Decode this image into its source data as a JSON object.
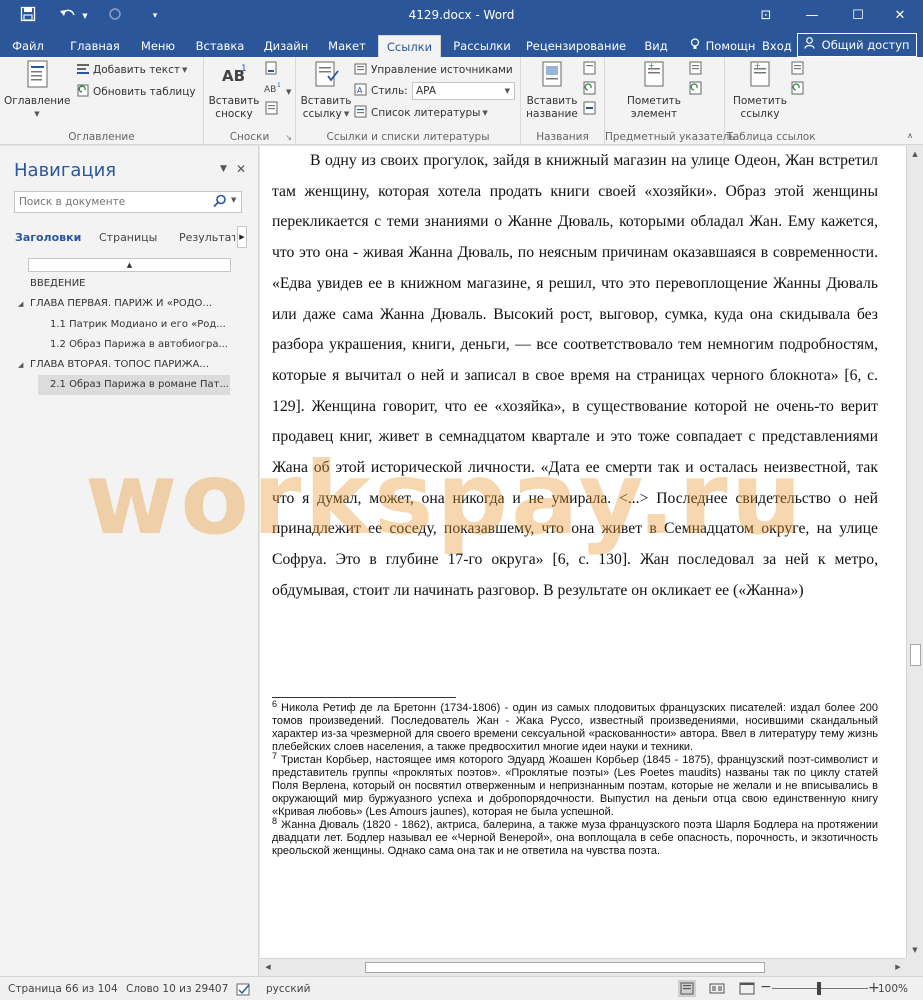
{
  "titlebar": {
    "title": "4129.docx - Word",
    "minimize": "—",
    "maximize": "☐",
    "close": "✕",
    "ribbon_options": "⊡"
  },
  "tabs": [
    {
      "label": "Файл"
    },
    {
      "label": "Главная"
    },
    {
      "label": "Меню"
    },
    {
      "label": "Вставка"
    },
    {
      "label": "Дизайн"
    },
    {
      "label": "Макет"
    },
    {
      "label": "Ссылки"
    },
    {
      "label": "Рассылки"
    },
    {
      "label": "Рецензирование"
    },
    {
      "label": "Вид"
    }
  ],
  "tab_extras": {
    "help": "Помощн",
    "signin": "Вход",
    "share": "Общий доступ"
  },
  "ribbon": {
    "toc": {
      "button": "Оглавление",
      "add_text": "Добавить текст",
      "update_table": "Обновить таблицу",
      "group": "Оглавление"
    },
    "footnotes": {
      "insert": "Вставить",
      "insert2": "сноску",
      "group": "Сноски"
    },
    "citations": {
      "insert": "Вставить",
      "insert2": "ссылку",
      "manage_sources": "Управление источниками",
      "style_label": "Стиль:",
      "style_value": "APA",
      "bibliography": "Список литературы",
      "group": "Ссылки и списки литературы"
    },
    "captions": {
      "insert": "Вставить",
      "insert2": "название",
      "group": "Названия"
    },
    "index": {
      "mark": "Пометить",
      "mark2": "элемент",
      "group": "Предметный указатель"
    },
    "toa": {
      "mark": "Пометить",
      "mark2": "ссылку",
      "group": "Таблица ссылок"
    }
  },
  "nav": {
    "title": "Навигация",
    "search_placeholder": "Поиск в документе",
    "tabs": [
      "Заголовки",
      "Страницы",
      "Результаты"
    ],
    "headings": [
      {
        "text": "ВВЕДЕНИЕ",
        "level": 1,
        "expander": ""
      },
      {
        "text": "ГЛАВА ПЕРВАЯ. ПАРИЖ И «РОДО...",
        "level": 1,
        "expander": "◢"
      },
      {
        "text": "1.1 Патрик Модиано и его «Род...",
        "level": 2,
        "expander": ""
      },
      {
        "text": "1.2 Образ Парижа в автобиогра...",
        "level": 2,
        "expander": ""
      },
      {
        "text": "ГЛАВА ВТОРАЯ. ТОПОС ПАРИЖА...",
        "level": 1,
        "expander": "◢"
      },
      {
        "text": "2.1 Образ Парижа в романе Пат...",
        "level": 2,
        "expander": "",
        "selected": true
      }
    ]
  },
  "document": {
    "paragraph": "В одну из своих прогулок, зайдя в книжный магазин на улице Одеон, Жан встретил там женщину, которая хотела продать книги своей «хозяйки». Образ этой женщины перекликается с теми знаниями о Жанне Дюваль, которыми обладал Жан. Ему кажется, что это она - живая Жанна Дюваль, по неясным причинам оказавшаяся в современности. «Едва увидев ее в книжном магазине, я решил, что это перевоплощение Жанны Дюваль или даже сама Жанна Дюваль. Высокий рост, выговор, сумка, куда она скидывала без разбора украшения, книги, деньги, — все соответствовало тем немногим подробностям, которые я вычитал о ней и записал в свое время на страницах черного блокнота» [6, с. 129]. Женщина говорит, что ее «хозяйка», в существование которой не очень-то верит продавец книг, живет в семнадцатом квартале и это тоже совпадает с представлениями Жана об этой исторической личности. «Дата ее смерти так и осталась неизвестной, так что я думал, может, она никогда и не умирала. <...> Последнее свидетельство о ней принадлежит ее соседу, показавшему, что она живет в Семнадцатом округе, на улице Софруа. Это в глубине 17-го округа» [6, с. 130]. Жан последовал за ней к метро, обдумывая, стоит ли начинать разговор. В результате он окликает ее («Жанна»)",
    "footnotes": [
      {
        "num": "6",
        "text": "Никола Ретиф де ла Бретонн (1734-1806) - один из самых плодовитых французских писателей: издал более 200 томов произведений. Последователь Жан - Жака Руссо, известный произведениями, носившими скандальный характер из-за чрезмерной для своего времени сексуальной «раскованности» автора. Ввел в литературу тему жизнь плебейских слоев населения, а также предвосхитил многие идеи науки и техники."
      },
      {
        "num": "7",
        "text": "Тристан Корбьер, настоящее имя которого Эдуард Жоашен Корбьер (1845 - 1875), французский поэт-символист и представитель группы «проклятых поэтов». «Проклятые поэты» (Les Poetes maudits) названы так по циклу статей Поля Верлена, который он посвятил отверженным и непризнанным поэтам, которые не желали и не вписывались в окружающий мир буржуазного успеха и добропорядочности. Выпустил на деньги отца свою единственную книгу «Кривая любовь» (Les Amours jaunes), которая не была успешной."
      },
      {
        "num": "8",
        "text": "Жанна Дюваль (1820 - 1862), актриса, балерина, а также муза французского поэта Шарля Бодлера на протяжении двадцати лет. Бодлер называл ее «Черной Венерой», она воплощала в себе опасность, порочность, и экзотичность креольской женщины. Однако сама она так и не ответила на чувства поэта."
      }
    ],
    "watermark": "workspay.ru"
  },
  "status": {
    "page": "Страница 66 из 104",
    "words": "Слово 10 из 29407",
    "language": "русский",
    "zoom": "100%",
    "zoom_minus": "−",
    "zoom_plus": "+"
  },
  "colors": {
    "accent": "#2b579a",
    "watermark": "#e8962d"
  }
}
